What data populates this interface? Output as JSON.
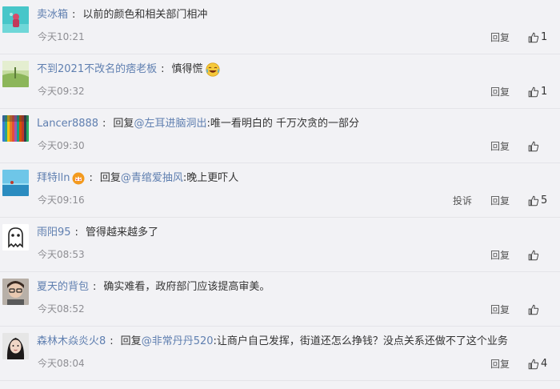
{
  "comments": [
    {
      "username": "卖冰箱",
      "reply_prefix": "",
      "mention": "",
      "text": "以前的颜色和相关部门相冲",
      "time": "今天10:21",
      "report_label": "",
      "reply_label": "回复",
      "likes": "1",
      "avatar": "avatar-teal-figure"
    },
    {
      "username": "不到2021不改名的痞老板",
      "reply_prefix": "",
      "mention": "",
      "text": "慎得慌",
      "time": "今天09:32",
      "report_label": "",
      "reply_label": "回复",
      "likes": "1",
      "avatar": "avatar-green-field"
    },
    {
      "username": "Lancer8888",
      "reply_prefix": "回复",
      "mention": "@左耳进脑洞出",
      "text": ":唯一看明白的 千万次贪的一部分",
      "time": "今天09:30",
      "report_label": "",
      "reply_label": "回复",
      "likes": "",
      "avatar": "avatar-colored-pencils"
    },
    {
      "username": "拜特lln",
      "reply_prefix": "回复",
      "mention": "@青绾爱抽风",
      "text": ":晚上更吓人",
      "time": "今天09:16",
      "report_label": "投诉",
      "reply_label": "回复",
      "likes": "5",
      "avatar": "avatar-sea-sky"
    },
    {
      "username": "雨阳95",
      "reply_prefix": "",
      "mention": "",
      "text": "管得越来越多了",
      "time": "今天08:53",
      "report_label": "",
      "reply_label": "回复",
      "likes": "",
      "avatar": "avatar-ghost"
    },
    {
      "username": "夏天的背包",
      "reply_prefix": "",
      "mention": "",
      "text": "确实难看，政府部门应该提高审美。",
      "time": "今天08:52",
      "report_label": "",
      "reply_label": "回复",
      "likes": "",
      "avatar": "avatar-person-glasses"
    },
    {
      "username": "森林木焱炎火8",
      "reply_prefix": "回复",
      "mention": "@非常丹丹520",
      "text": ":让商户自己发挥，街道还怎么挣钱？没点关系还做不了这个业务",
      "time": "今天08:04",
      "report_label": "",
      "reply_label": "回复",
      "likes": "4",
      "avatar": "avatar-girl-portrait"
    }
  ],
  "colors": {
    "background": "#f2f2f5",
    "username": "#5f7fb0",
    "time": "#8e8e93",
    "divider": "#e4e4e8"
  },
  "icons": [
    "thumbs-up-icon",
    "laughing-emoji-icon",
    "vip-crown-icon"
  ]
}
